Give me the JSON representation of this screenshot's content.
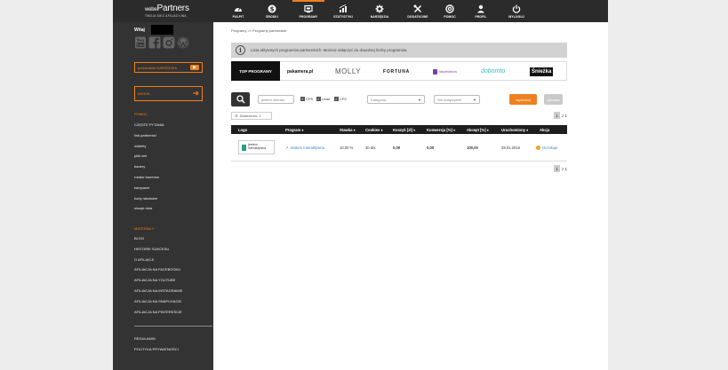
{
  "header": {
    "logo_main": "webe",
    "logo_brand": "Partners",
    "logo_sub": "TWOJA SIEĆ AFILIACYJNA",
    "nav": [
      {
        "label": "PULPIT",
        "icon": "dashboard-icon"
      },
      {
        "label": "ŚRODKI",
        "icon": "money-icon"
      },
      {
        "label": "PROGRAMY",
        "icon": "programs-icon"
      },
      {
        "label": "STATYSTYKI",
        "icon": "statistics-icon"
      },
      {
        "label": "NARZĘDZIA",
        "icon": "tools-icon"
      },
      {
        "label": "DODATKOWE",
        "icon": "extras-icon"
      },
      {
        "label": "POMOC",
        "icon": "help-icon"
      },
      {
        "label": "PROFIL",
        "icon": "profile-icon"
      },
      {
        "label": "WYLOGUJ",
        "icon": "logout-icon"
      }
    ],
    "accent": "#f0801e"
  },
  "sidebar": {
    "welcome": "Witaj",
    "socials": [
      "youtube-icon",
      "facebook-icon",
      "instagram-icon",
      "wordpress-icon"
    ],
    "btn1_label": "przewodnik NARZĘDZIA",
    "btn1_badge": "▶",
    "btn2_label": "eBOOK",
    "btn2_arrow": "➔",
    "pomoc_title": "POMOC",
    "pomoc_items": [
      "CZĘSTE PYTANIA",
      "link partnerski",
      "widżety",
      "pliki xml",
      "banery",
      "rotator banerów",
      "kampanie",
      "kody rabatowe",
      "okazje dnia"
    ],
    "materialy_title": "MATERIAŁY",
    "materialy_items": [
      "BLOG",
      "HISTORIE SUKCESU",
      "O AFILIACJI",
      "AFILIACJA NA FACEBOOKU",
      "AFILIACJA NA YOUTUBE",
      "AFILIACJA NA INSTAGRAMIE",
      "AFILIACJA NA SNAPCHACIE",
      "AFILIACJA NA PINTEREŚCIE"
    ],
    "bottom_items": [
      "REGULAMIN",
      "POLITYKA PRYWATNOŚCI"
    ]
  },
  "main": {
    "breadcrumb": "Programy >> Programy partnerskie",
    "info_icon": "i",
    "info_text": "Lista aktywnych programów partnerskich. Możesz dołączyć do dowolnej liczby programów.",
    "top_programs": "TOP PROGRAMY",
    "partner_logos": [
      "pakamera.pl",
      "MOLLY",
      "FORTUNA",
      "tabyleizdrow",
      "dobomto",
      "Śnieżka"
    ],
    "search": {
      "name_placeholder": "jestem interakt",
      "cps": "CPS",
      "lead": "Lead",
      "cpc": "CPC",
      "category": "Kategoria",
      "status": "Nie dołączyłem",
      "search_btn": "wyszukaj",
      "clear_btn": "wyczyść"
    },
    "found": "Znaleziono: 1",
    "pager_page": "1",
    "pager_total": "z 1",
    "table": {
      "headers": [
        "Logo",
        "Program ♦",
        "Stawka ♦",
        "Cookies ♦",
        "Koszyk [zł] ♦",
        "Konwersja [%] ♦",
        "Akcept [%] ♦",
        "Uruchomiony ♦",
        "Akcja"
      ],
      "row": {
        "logo_text": "jestem interaktywna",
        "program": "Jestem Interaktywna",
        "stawka": "10,00 %",
        "cookies": "30 dni",
        "koszyk": "0,00",
        "konwersja": "0,00",
        "akcept": "100,00",
        "uruchomiony": "29.01.2016",
        "akcja": "Oczekuje"
      }
    }
  }
}
